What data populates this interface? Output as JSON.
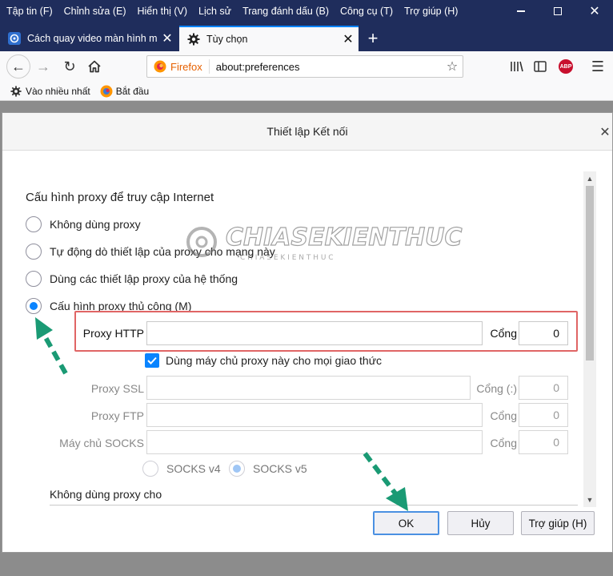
{
  "menubar": {
    "items": [
      "Tập tin (F)",
      "Chỉnh sửa (E)",
      "Hiển thị (V)",
      "Lịch sử",
      "Trang đánh dấu (B)",
      "Công cụ (T)",
      "Trợ giúp (H)"
    ]
  },
  "tabs": [
    {
      "title": "Cách quay video màn hình máy",
      "active": false,
      "icon": "site-favicon"
    },
    {
      "title": "Tùy chọn",
      "active": true,
      "icon": "gear-icon"
    }
  ],
  "urlbar": {
    "identity_label": "Firefox",
    "url": "about:preferences"
  },
  "toolbar": {
    "adblock_label": "ABP"
  },
  "bookmarks": [
    {
      "label": "Vào nhiều nhất",
      "icon": "gear-icon"
    },
    {
      "label": "Bắt đầu",
      "icon": "firefox-icon"
    }
  ],
  "dialog": {
    "title": "Thiết lập Kết nối",
    "section_title": "Cấu hình proxy để truy cập Internet",
    "options": [
      {
        "label": "Không dùng proxy",
        "selected": false
      },
      {
        "label": "Tự động dò thiết lập của proxy cho mạng này",
        "selected": false
      },
      {
        "label": "Dùng các thiết lập proxy của hệ thống",
        "selected": false
      },
      {
        "label": "Cấu hình proxy thủ công (M)",
        "selected": true
      }
    ],
    "http_proxy": {
      "label": "Proxy HTTP",
      "value": "",
      "port_label": "Cổng",
      "port": "0"
    },
    "use_for_all": {
      "label": "Dùng máy chủ proxy này cho mọi giao thức",
      "checked": true
    },
    "ssl_proxy": {
      "label": "Proxy SSL",
      "value": "",
      "port_label": "Cổng (:)",
      "port": "0"
    },
    "ftp_proxy": {
      "label": "Proxy FTP",
      "value": "",
      "port_label": "Cổng",
      "port": "0"
    },
    "socks_host": {
      "label": "Máy chủ SOCKS",
      "value": "",
      "port_label": "Cổng",
      "port": "0"
    },
    "socks_versions": [
      {
        "label": "SOCKS v4",
        "selected": false
      },
      {
        "label": "SOCKS v5",
        "selected": true
      }
    ],
    "no_proxy_label": "Không dùng proxy cho",
    "buttons": {
      "ok": "OK",
      "cancel": "Hủy",
      "help": "Trợ giúp (H)"
    }
  },
  "watermark": {
    "text": "CHIASEKIENTHUC",
    "subtext": "C H I A   S E   K I E N   T H U C"
  },
  "colors": {
    "titlebar": "#1f2d5c",
    "accent": "#0a84ff",
    "highlight": "#e06565",
    "arrow": "#1a9a74"
  }
}
